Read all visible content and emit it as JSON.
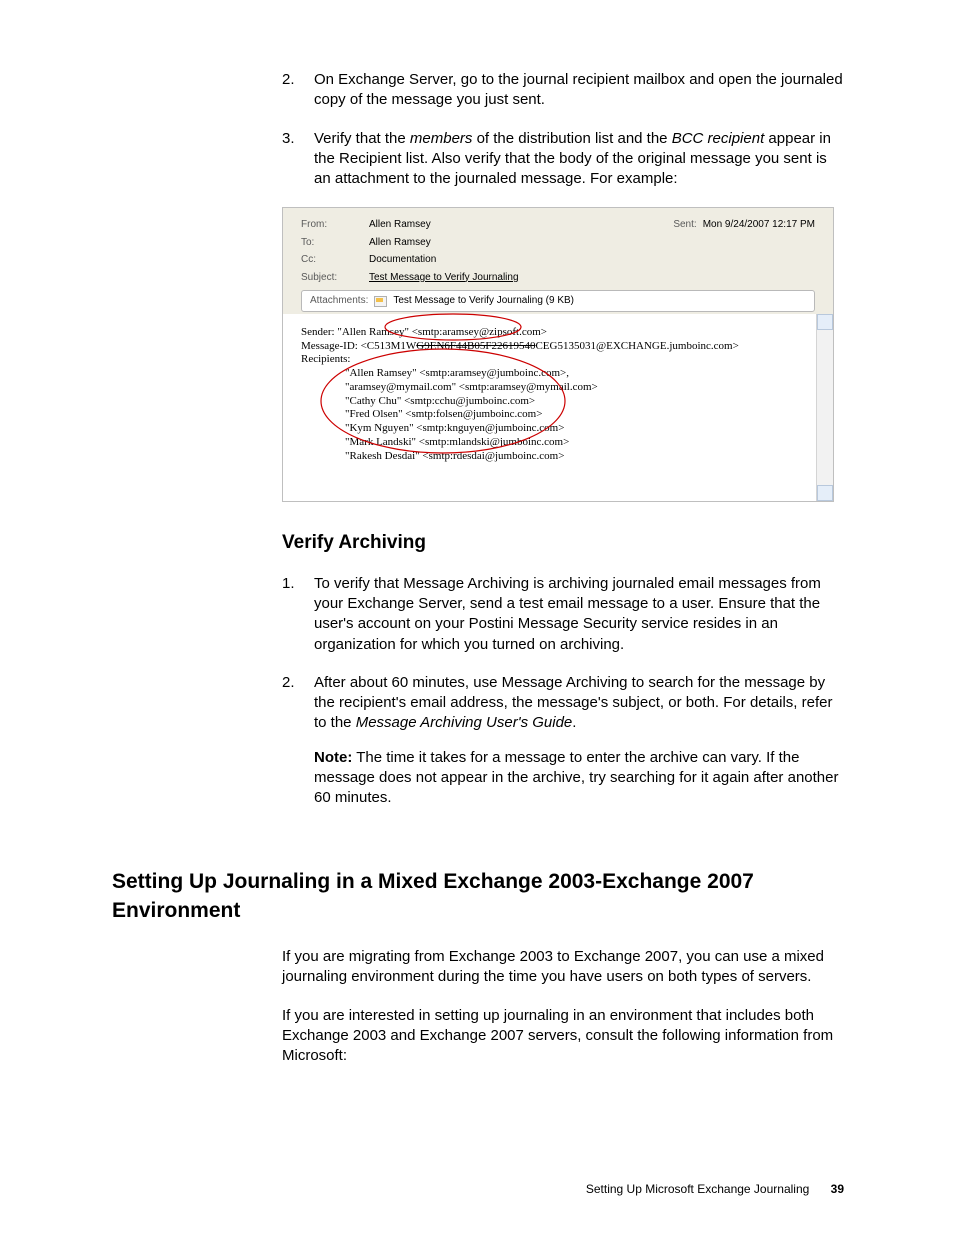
{
  "steps_a": [
    {
      "n": "2.",
      "text_pre": "On Exchange Server, go to the journal recipient mailbox and open the journaled copy of the message you just sent."
    },
    {
      "n": "3.",
      "text_pre": "Verify that the ",
      "em1": "members",
      "mid": " of the distribution list and the ",
      "em2": "BCC recipient",
      "post": " appear in the Recipient list. Also verify that the body of the original message you sent is an attachment to the journaled message. For example:"
    }
  ],
  "fig": {
    "from_l": "From:",
    "from": "Allen Ramsey",
    "sent_l": "Sent:",
    "sent": "Mon 9/24/2007 12:17 PM",
    "to_l": "To:",
    "to": "Allen Ramsey",
    "cc_l": "Cc:",
    "cc": "Documentation",
    "subj_l": "Subject:",
    "subj": "Test Message to Verify Journaling",
    "att_l": "Attachments:",
    "att": "Test Message to Verify Journaling (9 KB)",
    "sender": "Sender: \"Allen Ramsey\" <smtp:aramsey@zipsoft.com>",
    "msgid_pre": "Message-ID: <C513M1W",
    "msgid_strike": "G9EN6F44B05F22619540",
    "msgid_post": "CEG5135031@EXCHANGE.jumboinc.com>",
    "recip_l": "Recipients:",
    "recips": [
      "\"Allen Ramsey\" <smtp:aramsey@jumboinc.com>,",
      "\"aramsey@mymail.com\" <smtp:aramsey@mymail.com>",
      "\"Cathy Chu\" <smtp:cchu@jumboinc.com>",
      "\"Fred Olsen\" <smtp:folsen@jumboinc.com>",
      "\"Kym Nguyen\" <smtp:knguyen@jumboinc.com>",
      "\"Mark Landski\" <smtp:mlandski@jumboinc.com>",
      "\"Rakesh Desdai\" <smtp:rdesdai@jumboinc.com>"
    ]
  },
  "h2": "Verify Archiving",
  "steps_b": [
    {
      "n": "1.",
      "t": "To verify that Message Archiving is archiving journaled email messages from your Exchange Server, send a test email message to a user. Ensure that the user's account on your Postini Message Security service resides in an organization for which you turned on archiving."
    },
    {
      "n": "2.",
      "t_pre": "After about 60 minutes, use Message Archiving to search for the message by the recipient's email address, the message's subject, or both. For details, refer to the ",
      "t_em": "Message Archiving User's Guide",
      "t_post": "."
    }
  ],
  "note_l": "Note:",
  "note": " The time it takes for a message to enter the archive can vary. If the message does not appear in the archive, try searching for it again after another 60 minutes.",
  "h1": "Setting Up Journaling in a Mixed Exchange 2003-Exchange 2007 Environment",
  "p1": "If you are migrating from Exchange 2003 to Exchange 2007, you can use a mixed journaling environment during the time you have users on both types of servers.",
  "p2": "If you are interested in setting up journaling in an environment that includes both Exchange 2003 and Exchange 2007 servers, consult the following information from Microsoft:",
  "footer_t": "Setting Up Microsoft Exchange Journaling",
  "footer_n": "39"
}
